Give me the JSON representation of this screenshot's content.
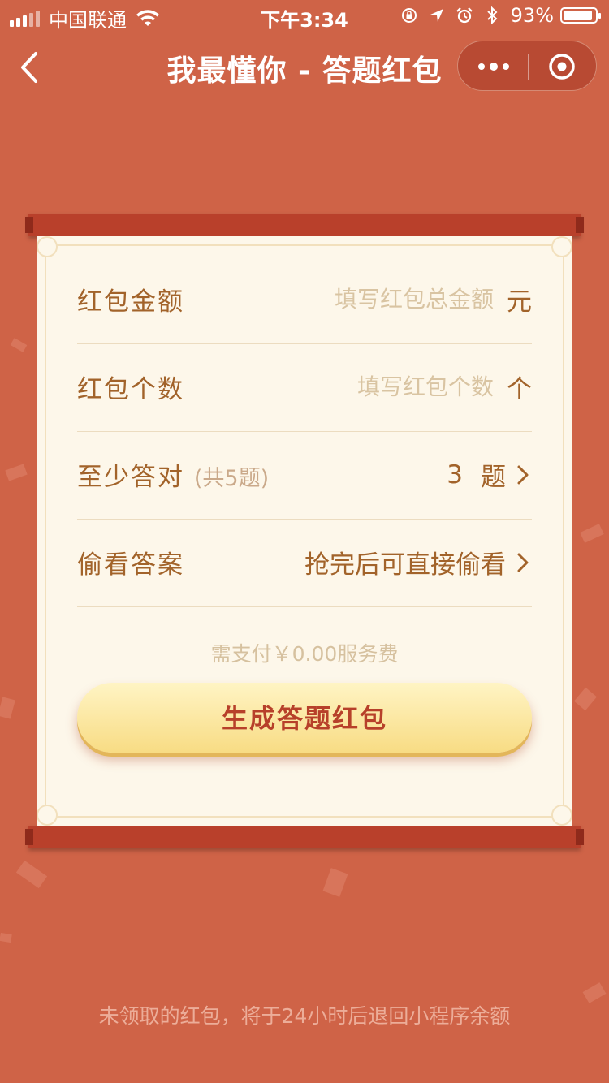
{
  "status_bar": {
    "carrier": "中国联通",
    "time": "下午3:34",
    "battery": "93%",
    "battery_level": 0.93
  },
  "nav": {
    "title": "我最懂你 - 答题红包"
  },
  "form": {
    "amount": {
      "label": "红包金额",
      "placeholder": "填写红包总金额",
      "unit": "元"
    },
    "count": {
      "label": "红包个数",
      "placeholder": "填写红包个数",
      "unit": "个"
    },
    "min_correct": {
      "label": "至少答对",
      "sub": "(共5题)",
      "value": "3",
      "unit": "题"
    },
    "peek": {
      "label": "偷看答案",
      "value": "抢完后可直接偷看"
    },
    "fee_text": "需支付￥0.00服务费",
    "submit_label": "生成答题红包"
  },
  "footer_note": "未领取的红包，将于24小时后退回小程序余额",
  "colors": {
    "background": "#cf6347",
    "paper": "#fdf7ea",
    "rod": "#b9402b",
    "label": "#a2632a",
    "button_text": "#b7402a"
  }
}
